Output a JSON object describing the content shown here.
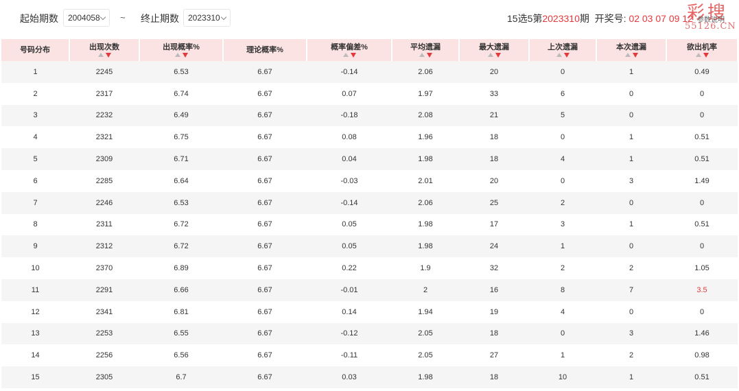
{
  "filters": {
    "start_label": "起始期数",
    "start_value": "2004058",
    "range_separator": "~",
    "end_label": "终止期数",
    "end_value": "2023310"
  },
  "draw": {
    "prefix": "15选5第",
    "issue": "2023310",
    "suffix": "期  开奖号:",
    "numbers": "02 03 07 09 12"
  },
  "explain_label": "参数说明",
  "logo": {
    "text": "彩搜",
    "domain": "55126.CN"
  },
  "columns": [
    {
      "label": "号码分布",
      "sortable": false
    },
    {
      "label": "出现次数",
      "sortable": true
    },
    {
      "label": "出现概率%",
      "sortable": true
    },
    {
      "label": "理论概率%",
      "sortable": false
    },
    {
      "label": "概率偏差%",
      "sortable": true
    },
    {
      "label": "平均遗漏",
      "sortable": true
    },
    {
      "label": "最大遗漏",
      "sortable": true
    },
    {
      "label": "上次遗漏",
      "sortable": true
    },
    {
      "label": "本次遗漏",
      "sortable": true
    },
    {
      "label": "欲出机率",
      "sortable": true
    }
  ],
  "rows": [
    [
      "1",
      "2245",
      "6.53",
      "6.67",
      "-0.14",
      "2.06",
      "20",
      "0",
      "1",
      "0.49"
    ],
    [
      "2",
      "2317",
      "6.74",
      "6.67",
      "0.07",
      "1.97",
      "33",
      "6",
      "0",
      "0"
    ],
    [
      "3",
      "2232",
      "6.49",
      "6.67",
      "-0.18",
      "2.08",
      "21",
      "5",
      "0",
      "0"
    ],
    [
      "4",
      "2321",
      "6.75",
      "6.67",
      "0.08",
      "1.96",
      "18",
      "0",
      "1",
      "0.51"
    ],
    [
      "5",
      "2309",
      "6.71",
      "6.67",
      "0.04",
      "1.98",
      "18",
      "4",
      "1",
      "0.51"
    ],
    [
      "6",
      "2285",
      "6.64",
      "6.67",
      "-0.03",
      "2.01",
      "20",
      "0",
      "3",
      "1.49"
    ],
    [
      "7",
      "2246",
      "6.53",
      "6.67",
      "-0.14",
      "2.06",
      "25",
      "2",
      "0",
      "0"
    ],
    [
      "8",
      "2311",
      "6.72",
      "6.67",
      "0.05",
      "1.98",
      "17",
      "3",
      "1",
      "0.51"
    ],
    [
      "9",
      "2312",
      "6.72",
      "6.67",
      "0.05",
      "1.98",
      "24",
      "1",
      "0",
      "0"
    ],
    [
      "10",
      "2370",
      "6.89",
      "6.67",
      "0.22",
      "1.9",
      "32",
      "2",
      "2",
      "1.05"
    ],
    [
      "11",
      "2291",
      "6.66",
      "6.67",
      "-0.01",
      "2",
      "16",
      "8",
      "7",
      "3.5"
    ],
    [
      "12",
      "2341",
      "6.81",
      "6.67",
      "0.14",
      "1.94",
      "19",
      "4",
      "0",
      "0"
    ],
    [
      "13",
      "2253",
      "6.55",
      "6.67",
      "-0.12",
      "2.05",
      "18",
      "0",
      "3",
      "1.46"
    ],
    [
      "14",
      "2256",
      "6.56",
      "6.67",
      "-0.11",
      "2.05",
      "27",
      "1",
      "2",
      "0.98"
    ],
    [
      "15",
      "2305",
      "6.7",
      "6.67",
      "0.03",
      "1.98",
      "18",
      "10",
      "1",
      "0.51"
    ]
  ],
  "highlight": {
    "row": 10,
    "col": 9,
    "color": "#e4393c"
  }
}
